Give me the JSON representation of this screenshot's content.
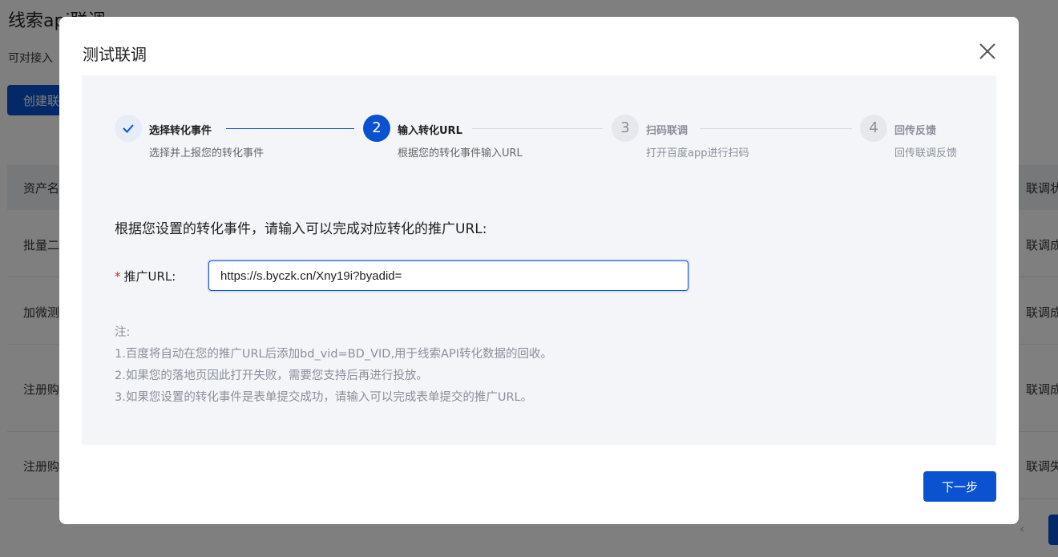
{
  "background": {
    "title": "线索api联调",
    "subtitle": "可对接入",
    "create_button": "创建联调",
    "table_header_left": "资产名",
    "table_header_right": "联调状态",
    "rows": [
      {
        "left": "批量二",
        "right": "联调成功"
      },
      {
        "left": "加微测",
        "right": "联调成功"
      },
      {
        "left": "注册购",
        "right": "联调成功"
      },
      {
        "left": "注册购",
        "right": "联调失败"
      }
    ],
    "pager_prev": "‹"
  },
  "modal": {
    "title": "测试联调",
    "close_icon": "close-icon",
    "steps": [
      {
        "index": "✓",
        "title": "选择转化事件",
        "desc": "选择并上报您的转化事件",
        "status": "done"
      },
      {
        "index": "2",
        "title": "输入转化URL",
        "desc": "根据您的转化事件输入URL",
        "status": "active"
      },
      {
        "index": "3",
        "title": "扫码联调",
        "desc": "打开百度app进行扫码",
        "status": "wait"
      },
      {
        "index": "4",
        "title": "回传反馈",
        "desc": "回传联调反馈",
        "status": "wait"
      }
    ],
    "instruction": "根据您设置的转化事件，请输入可以完成对应转化的推广URL:",
    "url_field": {
      "required_mark": "*",
      "label": "推广URL:",
      "value": "https://s.byczk.cn/Xny19i?byadid="
    },
    "note": {
      "title": "注:",
      "lines": [
        "1.百度将自动在您的推广URL后添加bd_vid=BD_VID,用于线索API转化数据的回收。",
        "2.如果您的落地页因此打开失败，需要您支持后再进行投放。",
        "3.如果您设置的转化事件是表单提交成功，请输入可以完成表单提交的推广URL。"
      ]
    },
    "next_button": "下一步"
  },
  "colors": {
    "primary": "#0b52d0",
    "panel_bg": "#f3f5f9",
    "required": "#e02020",
    "muted": "#8a8f99"
  }
}
